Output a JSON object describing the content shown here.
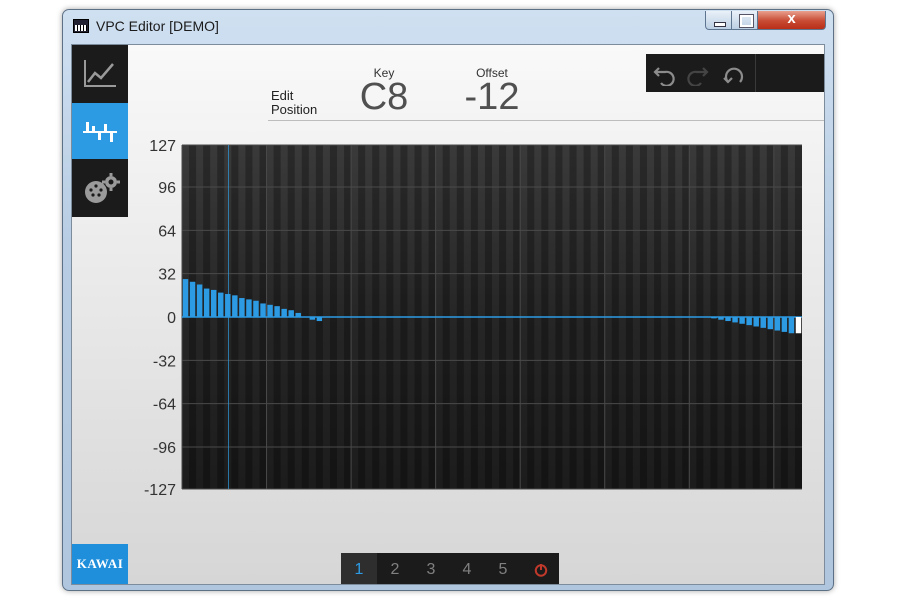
{
  "window": {
    "title": "VPC Editor [DEMO]",
    "buttons": {
      "minimize": "minimize",
      "maximize": "maximize",
      "close": "x"
    }
  },
  "sidebar": {
    "items": [
      {
        "id": "curve",
        "icon": "line-graph-icon",
        "active": false
      },
      {
        "id": "velocity",
        "icon": "bar-graph-icon",
        "active": true
      },
      {
        "id": "settings",
        "icon": "midi-gear-icon",
        "active": false
      }
    ],
    "brand": "KAWAI"
  },
  "edit_position": {
    "label_line1": "Edit",
    "label_line2": "Position",
    "key_label": "Key",
    "key_value": "C8",
    "offset_label": "Offset",
    "offset_value": "-12"
  },
  "toolbar": {
    "items": [
      {
        "icon": "undo-icon",
        "enabled": true
      },
      {
        "icon": "redo-icon",
        "enabled": false
      },
      {
        "icon": "reset-icon",
        "enabled": true
      }
    ]
  },
  "chart_data": {
    "type": "bar",
    "ylim": [
      -127,
      127
    ],
    "yticks": [
      "127",
      "96",
      "64",
      "32",
      "0",
      "-32",
      "-64",
      "-96",
      "-127"
    ],
    "grid": true,
    "key_count": 88,
    "selected_key_index": 87,
    "values": [
      28,
      26,
      24,
      21,
      20,
      18,
      17,
      16,
      14,
      13,
      12,
      10,
      9,
      8,
      6,
      5,
      3,
      0,
      -2,
      -3,
      0,
      0,
      0,
      0,
      0,
      0,
      0,
      0,
      0,
      0,
      0,
      0,
      0,
      0,
      0,
      0,
      0,
      0,
      0,
      0,
      0,
      0,
      0,
      0,
      0,
      0,
      0,
      0,
      0,
      0,
      0,
      0,
      0,
      0,
      0,
      0,
      0,
      0,
      0,
      0,
      0,
      0,
      0,
      0,
      0,
      0,
      0,
      0,
      0,
      0,
      0,
      0,
      0,
      0,
      0,
      -1,
      -2,
      -3,
      -4,
      -5,
      -6,
      -7,
      -8,
      -9,
      -10,
      -11,
      -12,
      -12
    ],
    "colors": {
      "bar": "#2d9be4",
      "selected": "#ffffff",
      "plot_bg": "#2a2a2a",
      "grid": "#4a4a4a",
      "zero_line": "#2d9be4",
      "cursor": "#2d9be4"
    }
  },
  "pages": {
    "items": [
      "1",
      "2",
      "3",
      "4",
      "5"
    ],
    "active": "1",
    "power_icon": "power-icon",
    "power_color": "#c0392b"
  }
}
